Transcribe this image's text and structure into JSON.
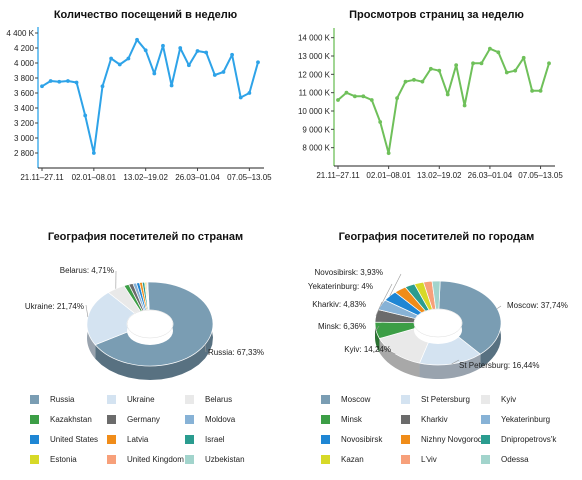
{
  "charts": [
    {
      "type": "line",
      "title": "Количество посещений в неделю",
      "color": "#2ea3e8",
      "ylim": [
        2600,
        4400
      ],
      "yticks": [
        2800,
        3000,
        3200,
        3400,
        3600,
        3800,
        4000,
        4200,
        4400
      ],
      "ytick_labels": [
        "2 800",
        "3 000",
        "3 200",
        "3 400",
        "3 600",
        "3 800",
        "4 000",
        "4 200",
        "4 400 K"
      ],
      "xtick_labels": [
        "21.11–27.11",
        "02.01–08.01",
        "13.02–19.02",
        "26.03–01.04",
        "07.05–13.05"
      ],
      "xtick_index": [
        0,
        6,
        12,
        18,
        24
      ],
      "values": [
        3690,
        3760,
        3750,
        3760,
        3740,
        3300,
        2800,
        3690,
        4060,
        3980,
        4060,
        4310,
        4170,
        3860,
        4230,
        3700,
        4200,
        3970,
        4160,
        4140,
        3840,
        3880,
        4110,
        3540,
        3600,
        4010
      ]
    },
    {
      "type": "line",
      "title": "Просмотров страниц за неделю",
      "color": "#6fc05a",
      "ylim": [
        7000,
        14200
      ],
      "yticks": [
        8000,
        9000,
        10000,
        11000,
        12000,
        13000,
        14000
      ],
      "ytick_labels": [
        "8 000 K",
        "9 000 K",
        "10 000 K",
        "11 000 K",
        "12 000 K",
        "13 000 K",
        "14 000 K"
      ],
      "xtick_labels": [
        "21.11–27.11",
        "02.01–08.01",
        "13.02–19.02",
        "26.03–01.04",
        "07.05–13.05"
      ],
      "xtick_index": [
        0,
        6,
        12,
        18,
        24
      ],
      "values": [
        10600,
        11000,
        10800,
        10800,
        10600,
        9400,
        7700,
        10700,
        11600,
        11700,
        11600,
        12300,
        12200,
        10900,
        12500,
        10300,
        12600,
        12600,
        13400,
        13200,
        12100,
        12200,
        12900,
        11100,
        11100,
        12600
      ]
    },
    {
      "type": "pie",
      "title": "География посетителей по странам",
      "slices": [
        {
          "name": "Russia",
          "value": 67.33,
          "color": "#7a9db3",
          "label": "Russia: 67,33%"
        },
        {
          "name": "Ukraine",
          "value": 21.74,
          "color": "#d4e3f1",
          "label": "Ukraine: 21,74%"
        },
        {
          "name": "Belarus",
          "value": 4.71,
          "color": "#e9e9e9",
          "label": "Belarus: 4,71%"
        },
        {
          "name": "Kazakhstan",
          "value": 1.3,
          "color": "#3c9e46",
          "label": ""
        },
        {
          "name": "Germany",
          "value": 1.1,
          "color": "#6b6b6b",
          "label": ""
        },
        {
          "name": "Moldova",
          "value": 0.9,
          "color": "#87b2d6",
          "label": ""
        },
        {
          "name": "United States",
          "value": 0.8,
          "color": "#1f86d4",
          "label": ""
        },
        {
          "name": "Latvia",
          "value": 0.7,
          "color": "#f08c19",
          "label": ""
        },
        {
          "name": "Israel",
          "value": 0.6,
          "color": "#2a9c8f",
          "label": ""
        },
        {
          "name": "Estonia",
          "value": 0.3,
          "color": "#d7d927",
          "label": ""
        },
        {
          "name": "United Kingdom",
          "value": 0.3,
          "color": "#f7a07a",
          "label": ""
        },
        {
          "name": "Uzbekistan",
          "value": 0.22,
          "color": "#a2d4cc",
          "label": ""
        }
      ]
    },
    {
      "type": "pie",
      "title": "География посетителей  по городам",
      "slices": [
        {
          "name": "Moscow",
          "value": 37.74,
          "color": "#7a9db3",
          "label": "Moscow: 37,74%"
        },
        {
          "name": "St Petersburg",
          "value": 16.44,
          "color": "#d4e3f1",
          "label": "St Petersburg: 16,44%"
        },
        {
          "name": "Kyiv",
          "value": 14.24,
          "color": "#e9e9e9",
          "label": "Kyiv: 14,24%"
        },
        {
          "name": "Minsk",
          "value": 6.36,
          "color": "#3c9e46",
          "label": "Minsk: 6,36%"
        },
        {
          "name": "Kharkiv",
          "value": 4.83,
          "color": "#6b6b6b",
          "label": "Kharkiv: 4,83%"
        },
        {
          "name": "Yekaterinburg",
          "value": 4.0,
          "color": "#87b2d6",
          "label": "Yekaterinburg: 4%"
        },
        {
          "name": "Novosibirsk",
          "value": 3.93,
          "color": "#1f86d4",
          "label": "Novosibirsk: 3,93%"
        },
        {
          "name": "Nizhny Novgorod",
          "value": 3.2,
          "color": "#f08c19",
          "label": ""
        },
        {
          "name": "Dnipropetrovs'k",
          "value": 2.6,
          "color": "#2a9c8f",
          "label": ""
        },
        {
          "name": "Kazan",
          "value": 2.4,
          "color": "#d7d927",
          "label": ""
        },
        {
          "name": "L'viv",
          "value": 2.2,
          "color": "#f7a07a",
          "label": ""
        },
        {
          "name": "Odessa",
          "value": 2.06,
          "color": "#a2d4cc",
          "label": ""
        }
      ]
    }
  ]
}
